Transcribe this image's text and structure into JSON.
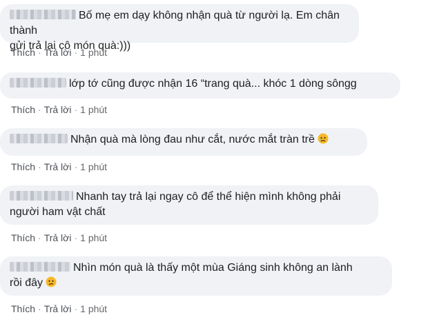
{
  "comments": [
    {
      "lines": [
        "Bố mẹ em dạy không nhận quà từ người lạ. Em chân thành",
        "gửi trả lại cô món quà:)))"
      ],
      "like": "Thích",
      "reply": "Trả lời",
      "time": "1 phút"
    },
    {
      "lines": [
        "lớp tớ cũng được nhận 16 “trang quà... khóc 1 dòng sôngg"
      ],
      "like": "Thích",
      "reply": "Trả lời",
      "time": "1 phút"
    },
    {
      "lines": [
        "Nhận quà mà lòng đau như cắt, nước mắt tràn trề"
      ],
      "emoji": "sad-face-icon",
      "like": "Thích",
      "reply": "Trả lời",
      "time": "1 phút"
    },
    {
      "lines": [
        "Nhanh tay trả lại ngay cô để thể hiện mình không phải",
        "người ham vật chất"
      ],
      "like": "Thích",
      "reply": "Trả lời",
      "time": "1 phút"
    },
    {
      "lines": [
        "Nhìn món quà là thấy một mùa Giáng sinh không an lành",
        "rồi đây"
      ],
      "emoji": "confused-face-icon",
      "like": "Thích",
      "reply": "Trả lời",
      "time": "1 phút"
    }
  ],
  "colors": {
    "bubble": "#f0f2f5",
    "text": "#1c1e21",
    "meta": "#65676b",
    "emoji": "#f7b928"
  }
}
